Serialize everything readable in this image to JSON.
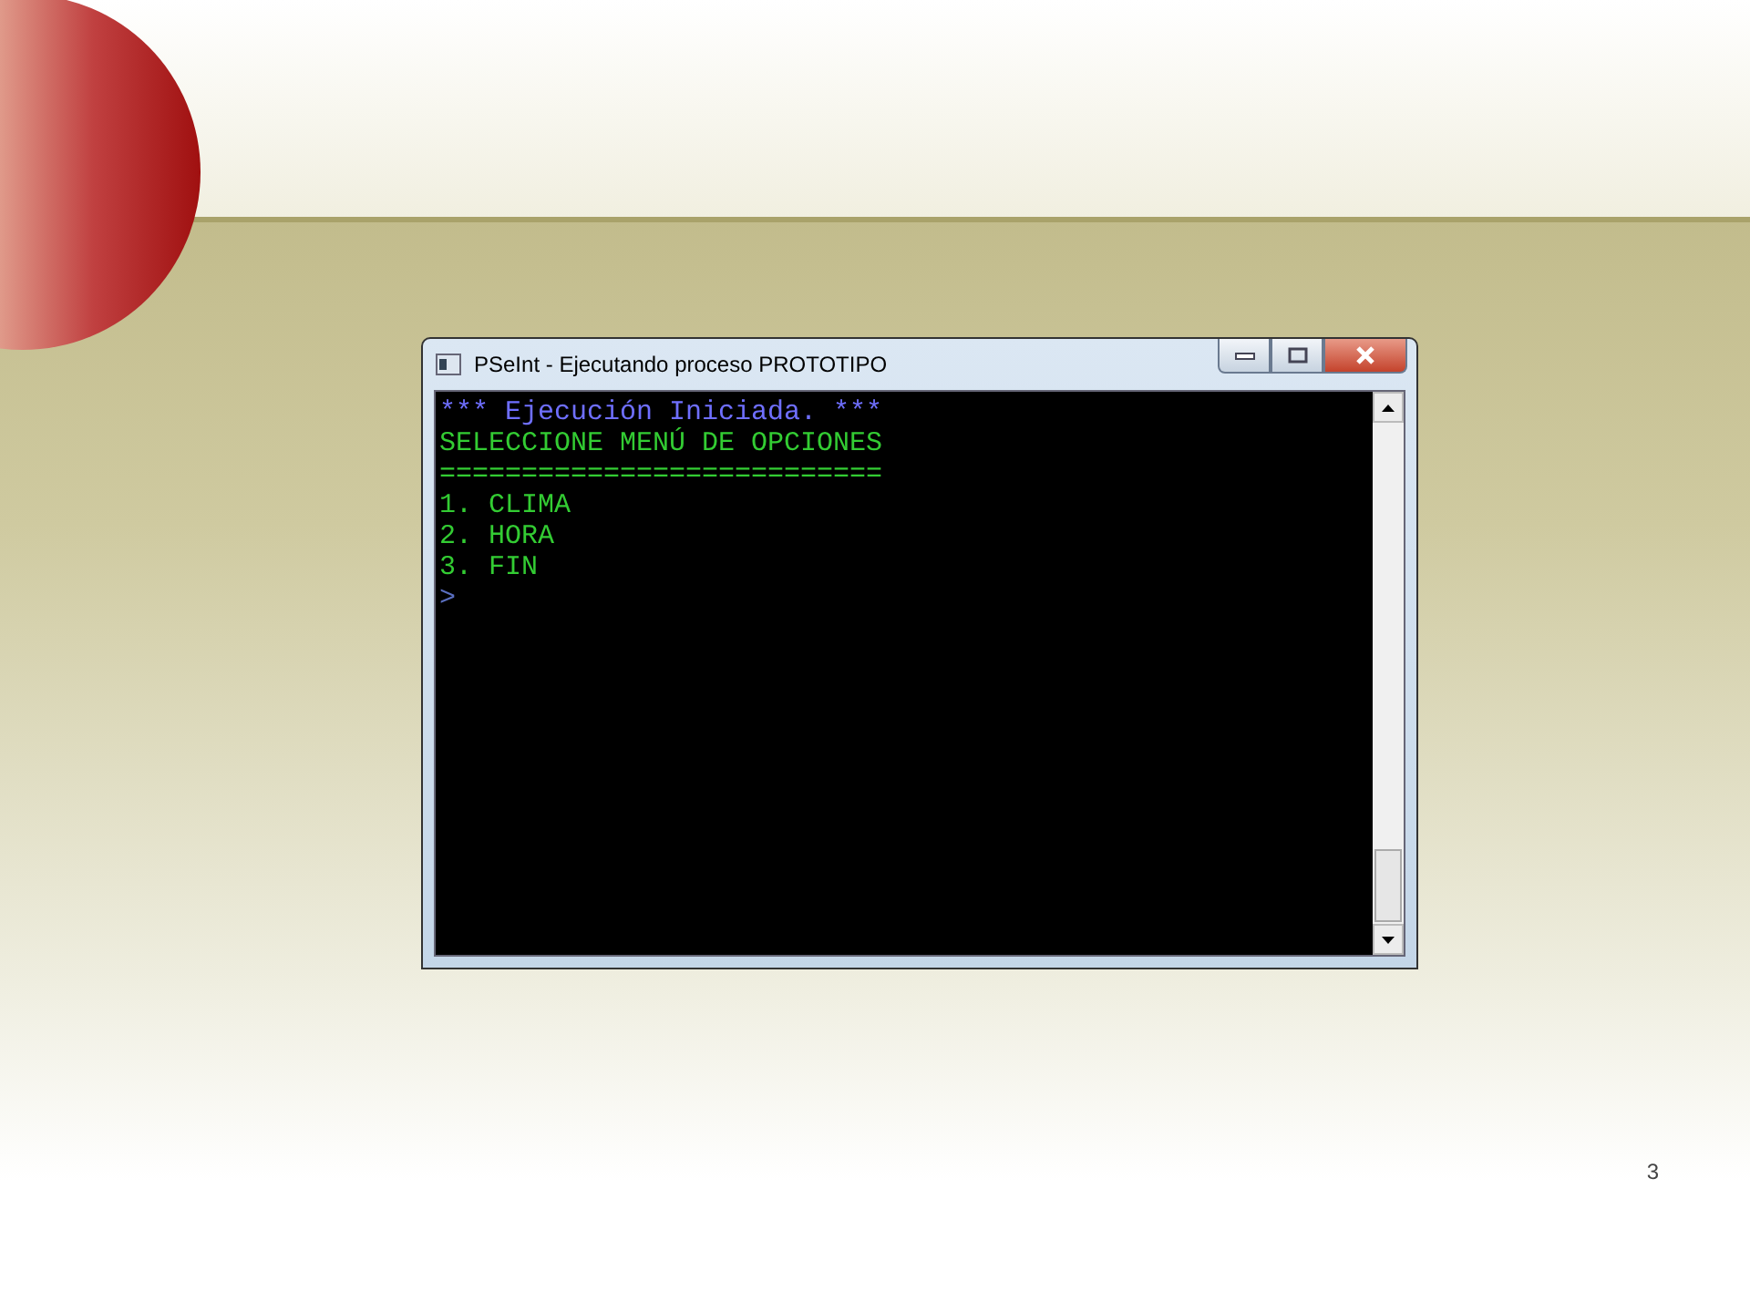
{
  "window": {
    "title": "PSeInt - Ejecutando proceso PROTOTIPO"
  },
  "console": {
    "lines": [
      {
        "text": "*** Ejecución Iniciada. ***",
        "color": "#6f6fff"
      },
      {
        "text": "SELECCIONE MENÚ DE OPCIONES",
        "color": "#33cc33"
      },
      {
        "text": "===========================",
        "color": "#33cc33"
      },
      {
        "text": "1. CLIMA",
        "color": "#33cc33"
      },
      {
        "text": "2. HORA",
        "color": "#33cc33"
      },
      {
        "text": "3. FIN",
        "color": "#33cc33"
      },
      {
        "text": ">",
        "color": "#5a6fc0"
      }
    ]
  },
  "slide_number": "3"
}
